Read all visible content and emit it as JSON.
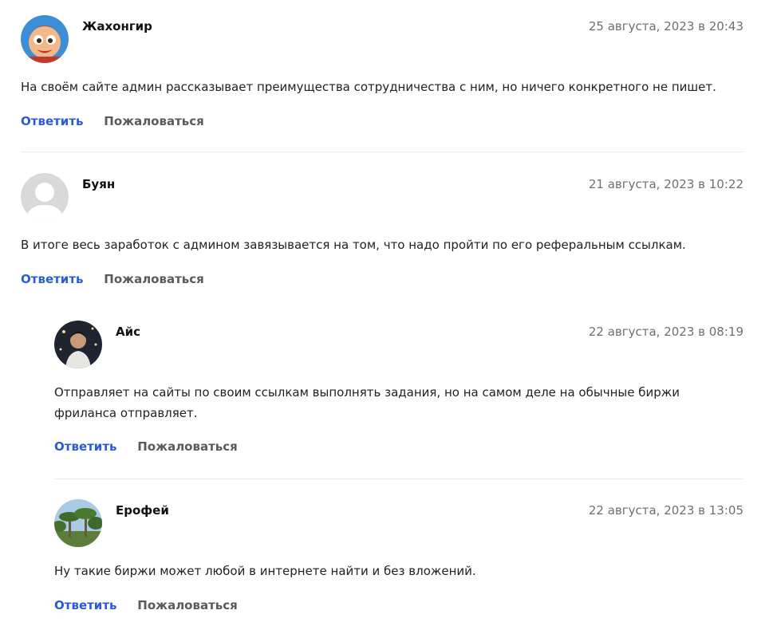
{
  "actions": {
    "reply_label": "Ответить",
    "complain_label": "Пожаловаться"
  },
  "comments": [
    {
      "author": "Жахонгир",
      "date": "25 августа, 2023 в 20:43",
      "text": "На своём сайте админ рассказывает преимущества сотрудничества с ним, но ничего конкретного не пишет.",
      "avatar_icon": "cartoon-boy-avatar"
    },
    {
      "author": "Буян",
      "date": "21 августа, 2023 в 10:22",
      "text": "В итоге весь заработок с админом завязывается на том, что надо пройти по его реферальным ссылкам.",
      "avatar_icon": "default-user-avatar"
    },
    {
      "author": "Айс",
      "date": "22 августа, 2023 в 08:19",
      "text": "Отправляет на сайты по своим ссылкам выполнять задания, но на самом деле на обычные биржи фриланса отправляет.",
      "avatar_icon": "man-photo-avatar"
    },
    {
      "author": "Ерофей",
      "date": "22 августа, 2023 в 13:05",
      "text": "Ну такие биржи может любой в интернете найти и без вложений.",
      "avatar_icon": "palm-trees-avatar"
    }
  ]
}
